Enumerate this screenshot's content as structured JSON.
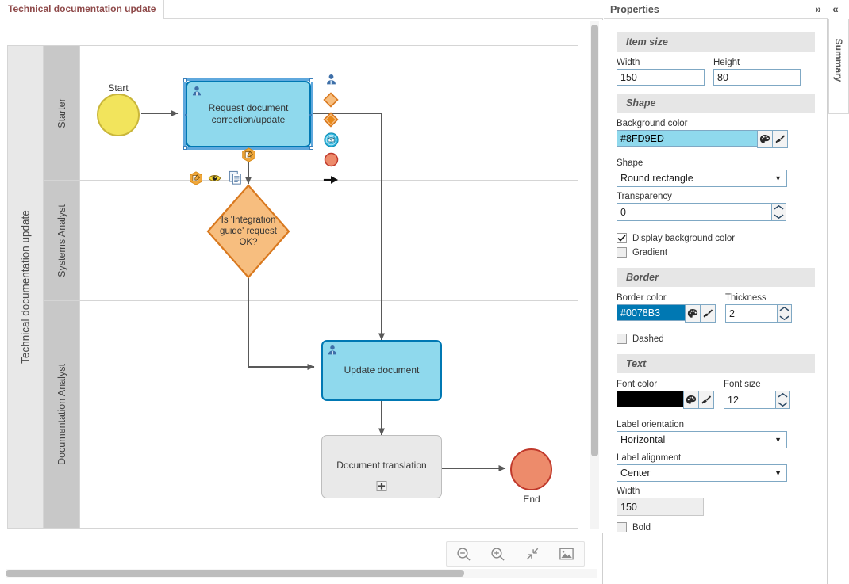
{
  "tabs": [
    {
      "label": "Technical documentation update",
      "active": true
    }
  ],
  "diagram": {
    "pool_title": "Technical documentation update",
    "lanes": [
      {
        "label": "Starter"
      },
      {
        "label": "Systems Analyst"
      },
      {
        "label": "Documentation Analyst"
      }
    ],
    "nodes": {
      "start": {
        "label": "Start",
        "fill": "#F5E israel",
        "type": "start-event"
      },
      "start_event": {
        "label": "Start",
        "fill": "#F2E45C",
        "stroke": "#C9B63A"
      },
      "request_task": {
        "label": "Request document correction/update",
        "fill": "#8FD9ED",
        "stroke": "#0078B3",
        "selected": true
      },
      "gateway": {
        "label": "Is 'Integration guide' request OK?",
        "fill": "#F7BE7F",
        "stroke": "#D9791F"
      },
      "update_task": {
        "label": "Update document",
        "fill": "#8FD9ED",
        "stroke": "#0078B3"
      },
      "translation_task": {
        "label": "Document translation",
        "fill": "#E9E9E9",
        "stroke": "#BDBDBD"
      },
      "end_event": {
        "label": "End",
        "fill": "#ED8B6B",
        "stroke": "#C0392B"
      }
    },
    "palette": [
      {
        "name": "user-task-tool",
        "title": "User task"
      },
      {
        "name": "gateway-tool",
        "title": "Gateway"
      },
      {
        "name": "event-gateway-tool",
        "title": "Complex gateway"
      },
      {
        "name": "message-event-tool",
        "title": "Message event"
      },
      {
        "name": "end-event-tool",
        "title": "End event"
      },
      {
        "name": "sequence-flow-tool",
        "title": "Sequence flow"
      }
    ],
    "shape_badges": [
      {
        "name": "form-badge",
        "title": "Form"
      },
      {
        "name": "eye-badge",
        "title": "Visibility"
      },
      {
        "name": "documents-badge",
        "title": "Documents"
      }
    ],
    "toolbar": [
      {
        "name": "zoom-out-button",
        "title": "Zoom out"
      },
      {
        "name": "zoom-in-button",
        "title": "Zoom in"
      },
      {
        "name": "fit-to-screen-button",
        "title": "Fit to screen"
      },
      {
        "name": "export-image-button",
        "title": "Export image"
      }
    ]
  },
  "properties": {
    "title": "Properties",
    "collapse_glyph": "»",
    "sections": {
      "item_size": {
        "heading": "Item size",
        "width_label": "Width",
        "width_value": "150",
        "height_label": "Height",
        "height_value": "80"
      },
      "shape": {
        "heading": "Shape",
        "bg_color_label": "Background color",
        "bg_color_value": "#8FD9ED",
        "shape_label": "Shape",
        "shape_value": "Round rectangle",
        "transparency_label": "Transparency",
        "transparency_value": "0",
        "display_bg_label": "Display background color",
        "display_bg_checked": true,
        "gradient_label": "Gradient",
        "gradient_checked": false
      },
      "border": {
        "heading": "Border",
        "border_color_label": "Border color",
        "border_color_value": "#0078B3",
        "thickness_label": "Thickness",
        "thickness_value": "2",
        "dashed_label": "Dashed",
        "dashed_checked": false
      },
      "text": {
        "heading": "Text",
        "font_color_label": "Font color",
        "font_color_value": "#000000",
        "font_size_label": "Font size",
        "font_size_value": "12",
        "label_orientation_label": "Label orientation",
        "label_orientation_value": "Horizontal",
        "label_alignment_label": "Label alignment",
        "label_alignment_value": "Center",
        "width_label": "Width",
        "width_value": "150",
        "bold_label": "Bold",
        "bold_checked": false
      }
    }
  },
  "summary": {
    "label": "Summary",
    "collapse_glyph": "«"
  }
}
